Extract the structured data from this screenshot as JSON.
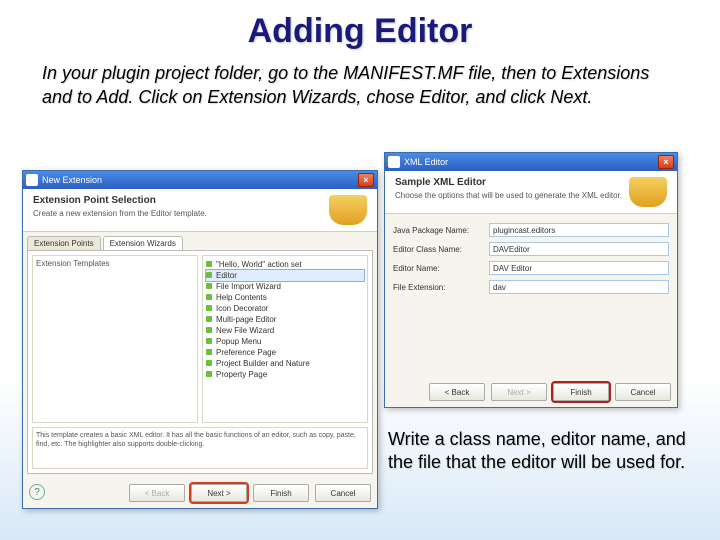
{
  "slide": {
    "title": "Adding Editor",
    "instruction1": "In your plugin project folder, go to the MANIFEST.MF file, then to Extensions and to Add. Click on Extension Wizards, chose Editor, and click Next.",
    "instruction2": "Write a class name, editor name, and the file that the editor will be used for."
  },
  "dialog1": {
    "title": "New Extension",
    "header": "Extension Point Selection",
    "subheader": "Create a new extension from the Editor template.",
    "tabs": {
      "points": "Extension Points",
      "wizards": "Extension Wizards"
    },
    "templates_label": "Extension Templates",
    "templates": [
      "\"Hello, World\" action set",
      "Editor",
      "File Import Wizard",
      "Help Contents",
      "Icon Decorator",
      "Multi-page Editor",
      "New File Wizard",
      "Popup Menu",
      "Preference Page",
      "Project Builder and Nature",
      "Property Page"
    ],
    "description": "This template creates a basic XML editor. It has all the basic functions of an editor, such as copy, paste, find, etc. The highlighter also supports double-clicking.",
    "buttons": {
      "back": "< Back",
      "next": "Next >",
      "finish": "Finish",
      "cancel": "Cancel"
    }
  },
  "dialog2": {
    "title": "XML Editor",
    "header": "Sample XML Editor",
    "subheader": "Choose the options that will be used to generate the XML editor.",
    "fields": {
      "pkg_label": "Java Package Name:",
      "pkg_value": "plugincast.editors",
      "class_label": "Editor Class Name:",
      "class_value": "DAVEditor",
      "name_label": "Editor Name:",
      "name_value": "DAV Editor",
      "ext_label": "File Extension:",
      "ext_value": "dav"
    },
    "buttons": {
      "back": "< Back",
      "next": "Next >",
      "finish": "Finish",
      "cancel": "Cancel"
    }
  }
}
